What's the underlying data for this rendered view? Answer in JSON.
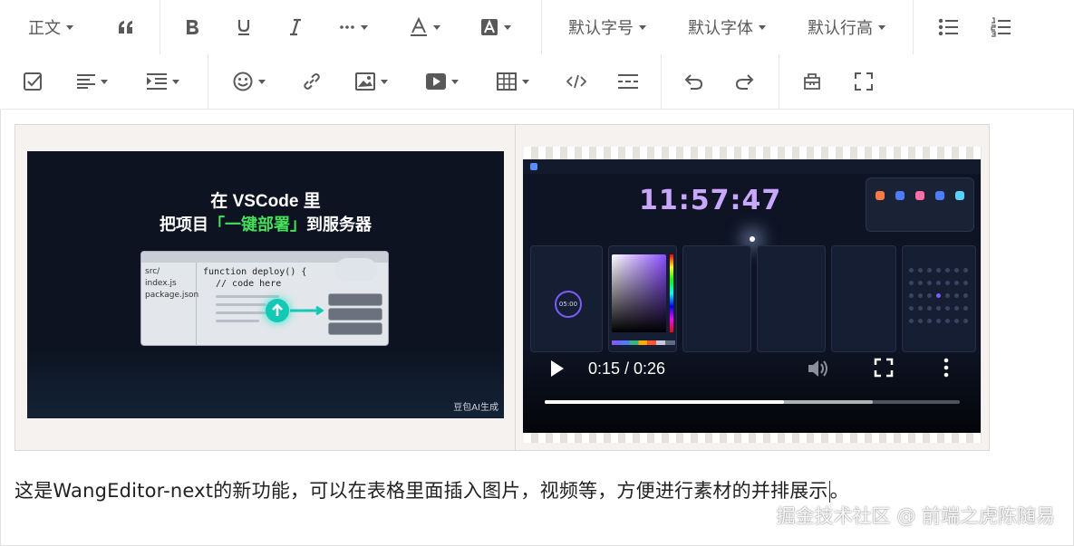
{
  "toolbar": {
    "heading_label": "正文",
    "font_size_label": "默认字号",
    "font_family_label": "默认字体",
    "line_height_label": "默认行高"
  },
  "table": {
    "image_cell": {
      "image_title_line1": "在 VSCode 里",
      "image_title_line2_a": "把项目",
      "image_title_line2_highlight": "「一键部署」",
      "image_title_line2_b": "到服务器",
      "image_files": [
        "src/",
        "index.js",
        "package.json"
      ],
      "image_code_line1": "function deploy() {",
      "image_code_line2": "// code here",
      "image_watermark": "豆包AI生成"
    },
    "video_cell": {
      "clock_time": "11:57:47",
      "timer_value": "05:00",
      "current_time": "0:15",
      "duration": "0:26",
      "time_display": "0:15 / 0:26",
      "progress_fraction": 0.577,
      "buffered_fraction": 0.79
    }
  },
  "paragraph": {
    "text": "这是WangEditor-next的新功能，可以在表格里面插入图片，视频等，方便进行素材的并排展示"
  },
  "paragraph_end_text": "。",
  "watermark_text": "掘金技术社区 @ 前端之虎陈随易",
  "colors": {
    "toolbar_icon": "#595959",
    "highlight_green": "#46e05a",
    "clock_purple": "#c9a6ff"
  }
}
